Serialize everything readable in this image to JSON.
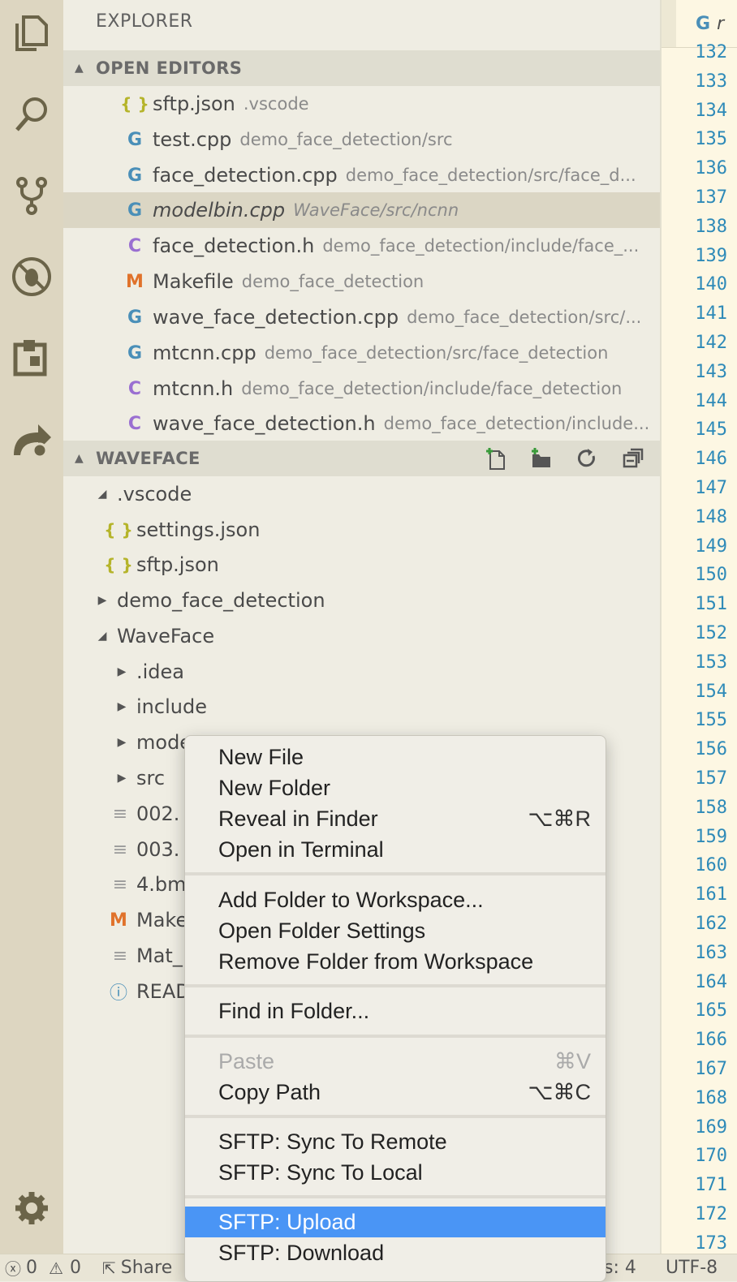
{
  "explorer": {
    "title": "EXPLORER"
  },
  "open_editors": {
    "header": "OPEN EDITORS",
    "items": [
      {
        "icon": "{ }",
        "name": "sftp.json",
        "desc": ".vscode"
      },
      {
        "icon": "C++",
        "name": "test.cpp",
        "desc": "demo_face_detection/src"
      },
      {
        "icon": "C++",
        "name": "face_detection.cpp",
        "desc": "demo_face_detection/src/face_d..."
      },
      {
        "icon": "C++",
        "name": "modelbin.cpp",
        "desc": "WaveFace/src/ncnn"
      },
      {
        "icon": "C",
        "name": "face_detection.h",
        "desc": "demo_face_detection/include/face_..."
      },
      {
        "icon": "M",
        "name": "Makefile",
        "desc": "demo_face_detection"
      },
      {
        "icon": "C++",
        "name": "wave_face_detection.cpp",
        "desc": "demo_face_detection/src/..."
      },
      {
        "icon": "C++",
        "name": "mtcnn.cpp",
        "desc": "demo_face_detection/src/face_detection"
      },
      {
        "icon": "C",
        "name": "mtcnn.h",
        "desc": "demo_face_detection/include/face_detection"
      },
      {
        "icon": "C",
        "name": "wave_face_detection.h",
        "desc": "demo_face_detection/include..."
      }
    ]
  },
  "workspace": {
    "header": "WAVEFACE",
    "items": [
      {
        "name": ".vscode"
      },
      {
        "name": "settings.json"
      },
      {
        "name": "sftp.json"
      },
      {
        "name": "demo_face_detection"
      },
      {
        "name": "WaveFace"
      },
      {
        "name": ".idea"
      },
      {
        "name": "include"
      },
      {
        "name": "mode"
      },
      {
        "name": "src"
      },
      {
        "name": "002."
      },
      {
        "name": "003."
      },
      {
        "name": "4.bm"
      },
      {
        "name": "Make"
      },
      {
        "name": "Mat_"
      },
      {
        "name": "READ"
      }
    ]
  },
  "editor": {
    "tab_label": "r",
    "line_numbers": [
      "132",
      "133",
      "134",
      "135",
      "136",
      "137",
      "138",
      "139",
      "140",
      "141",
      "142",
      "143",
      "144",
      "145",
      "146",
      "147",
      "148",
      "149",
      "150",
      "151",
      "152",
      "153",
      "154",
      "155",
      "156",
      "157",
      "158",
      "159",
      "160",
      "161",
      "162",
      "163",
      "164",
      "165",
      "166",
      "167",
      "168",
      "169",
      "170",
      "171",
      "172",
      "173"
    ]
  },
  "status_bar": {
    "errors": "0",
    "warnings": "0",
    "share": "Share",
    "spaces": "s: 4",
    "encoding": "UTF-8"
  },
  "context_menu": {
    "items": [
      {
        "label": "New File",
        "shortcut": ""
      },
      {
        "label": "New Folder",
        "shortcut": ""
      },
      {
        "label": "Reveal in Finder",
        "shortcut": "⌥⌘R"
      },
      {
        "label": "Open in Terminal",
        "shortcut": ""
      },
      {
        "label": "Add Folder to Workspace...",
        "shortcut": ""
      },
      {
        "label": "Open Folder Settings",
        "shortcut": ""
      },
      {
        "label": "Remove Folder from Workspace",
        "shortcut": ""
      },
      {
        "label": "Find in Folder...",
        "shortcut": ""
      },
      {
        "label": "Paste",
        "shortcut": "⌘V"
      },
      {
        "label": "Copy Path",
        "shortcut": "⌥⌘C"
      },
      {
        "label": "SFTP: Sync To Remote",
        "shortcut": ""
      },
      {
        "label": "SFTP: Sync To Local",
        "shortcut": ""
      },
      {
        "label": "SFTP: Upload",
        "shortcut": ""
      },
      {
        "label": "SFTP: Download",
        "shortcut": ""
      }
    ]
  },
  "colors": {
    "accent_highlight": "#4a95f5",
    "line_number": "#2e8ab8",
    "sidebar_bg": "#efede3",
    "activity_bg": "#ddd6c1"
  }
}
